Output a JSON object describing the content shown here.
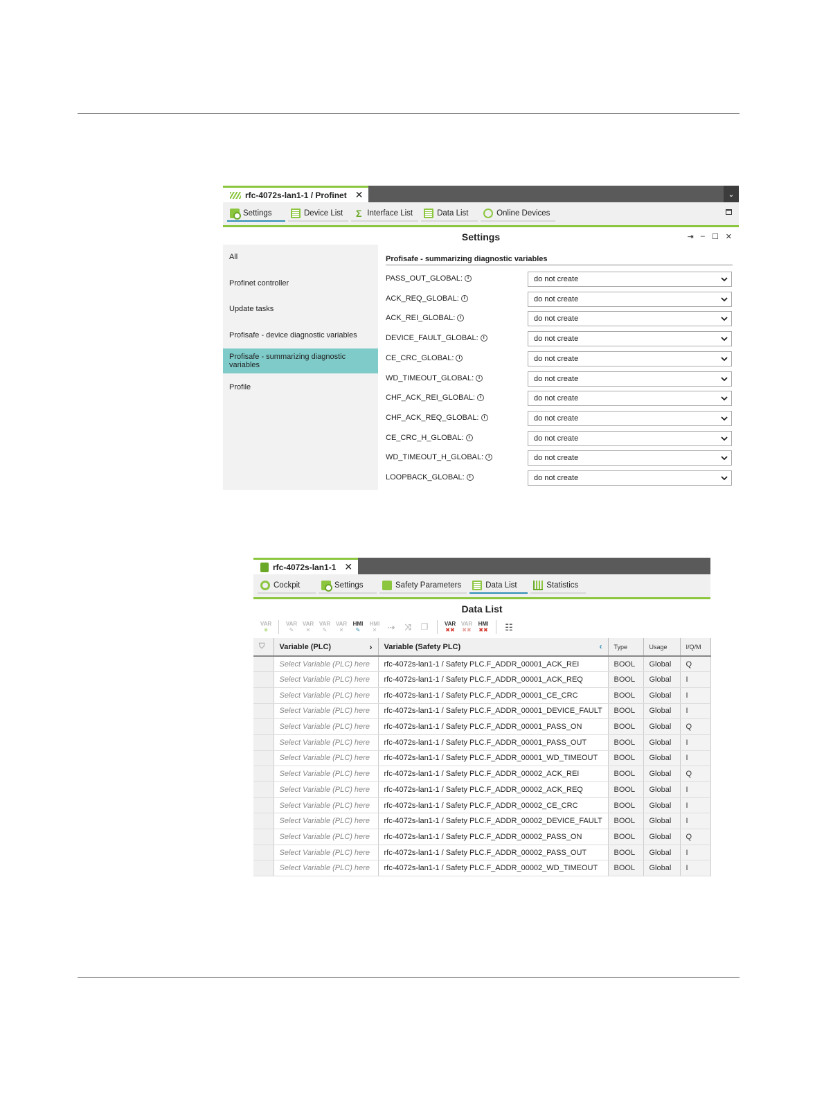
{
  "settings_panel": {
    "doc_tab": "rfc-4072s-lan1-1 / Profinet",
    "tools": [
      {
        "label": "Settings",
        "icon": "settings-icon"
      },
      {
        "label": "Device List",
        "icon": "device-list-icon"
      },
      {
        "label": "Interface List",
        "icon": "interface-list-icon"
      },
      {
        "label": "Data List",
        "icon": "data-list-icon"
      },
      {
        "label": "Online Devices",
        "icon": "online-devices-icon"
      }
    ],
    "title": "Settings",
    "nav": [
      "All",
      "Profinet controller",
      "Update tasks",
      "Profisafe - device diagnostic variables",
      "Profisafe - summarizing diagnostic variables",
      "Profile"
    ],
    "section_title": "Profisafe - summarizing diagnostic variables",
    "rows": [
      {
        "label": "PASS_OUT_GLOBAL:",
        "value": "do not create"
      },
      {
        "label": "ACK_REQ_GLOBAL:",
        "value": "do not create"
      },
      {
        "label": "ACK_REI_GLOBAL:",
        "value": "do not create"
      },
      {
        "label": "DEVICE_FAULT_GLOBAL:",
        "value": "do not create"
      },
      {
        "label": "CE_CRC_GLOBAL:",
        "value": "do not create"
      },
      {
        "label": "WD_TIMEOUT_GLOBAL:",
        "value": "do not create"
      },
      {
        "label": "CHF_ACK_REI_GLOBAL:",
        "value": "do not create"
      },
      {
        "label": "CHF_ACK_REQ_GLOBAL:",
        "value": "do not create"
      },
      {
        "label": "CE_CRC_H_GLOBAL:",
        "value": "do not create"
      },
      {
        "label": "WD_TIMEOUT_H_GLOBAL:",
        "value": "do not create"
      },
      {
        "label": "LOOPBACK_GLOBAL:",
        "value": "do not create"
      }
    ]
  },
  "data_panel": {
    "doc_tab": "rfc-4072s-lan1-1",
    "tools": [
      {
        "label": "Cockpit",
        "icon": "cockpit-icon"
      },
      {
        "label": "Settings",
        "icon": "settings-icon"
      },
      {
        "label": "Safety Parameters",
        "icon": "safety-parameters-icon"
      },
      {
        "label": "Data List",
        "icon": "data-list-icon"
      },
      {
        "label": "Statistics",
        "icon": "statistics-icon"
      }
    ],
    "title": "Data List",
    "toolbar_icons": [
      "VAR",
      "VAR",
      "VAR",
      "VAR",
      "VAR",
      "HMI",
      "HMI",
      "VAR",
      "VAR",
      "HMI"
    ],
    "columns": {
      "var_plc": "Variable (PLC)",
      "var_safety": "Variable (Safety PLC)",
      "type": "Type",
      "usage": "Usage",
      "iqm": "I/Q/M"
    },
    "rows": [
      {
        "plc": "Select Variable (PLC) here",
        "safety": "rfc-4072s-lan1-1 / Safety PLC.F_ADDR_00001_ACK_REI",
        "type": "BOOL",
        "usage": "Global",
        "iqm": "Q"
      },
      {
        "plc": "Select Variable (PLC) here",
        "safety": "rfc-4072s-lan1-1 / Safety PLC.F_ADDR_00001_ACK_REQ",
        "type": "BOOL",
        "usage": "Global",
        "iqm": "I"
      },
      {
        "plc": "Select Variable (PLC) here",
        "safety": "rfc-4072s-lan1-1 / Safety PLC.F_ADDR_00001_CE_CRC",
        "type": "BOOL",
        "usage": "Global",
        "iqm": "I"
      },
      {
        "plc": "Select Variable (PLC) here",
        "safety": "rfc-4072s-lan1-1 / Safety PLC.F_ADDR_00001_DEVICE_FAULT",
        "type": "BOOL",
        "usage": "Global",
        "iqm": "I"
      },
      {
        "plc": "Select Variable (PLC) here",
        "safety": "rfc-4072s-lan1-1 / Safety PLC.F_ADDR_00001_PASS_ON",
        "type": "BOOL",
        "usage": "Global",
        "iqm": "Q"
      },
      {
        "plc": "Select Variable (PLC) here",
        "safety": "rfc-4072s-lan1-1 / Safety PLC.F_ADDR_00001_PASS_OUT",
        "type": "BOOL",
        "usage": "Global",
        "iqm": "I"
      },
      {
        "plc": "Select Variable (PLC) here",
        "safety": "rfc-4072s-lan1-1 / Safety PLC.F_ADDR_00001_WD_TIMEOUT",
        "type": "BOOL",
        "usage": "Global",
        "iqm": "I"
      },
      {
        "plc": "Select Variable (PLC) here",
        "safety": "rfc-4072s-lan1-1 / Safety PLC.F_ADDR_00002_ACK_REI",
        "type": "BOOL",
        "usage": "Global",
        "iqm": "Q"
      },
      {
        "plc": "Select Variable (PLC) here",
        "safety": "rfc-4072s-lan1-1 / Safety PLC.F_ADDR_00002_ACK_REQ",
        "type": "BOOL",
        "usage": "Global",
        "iqm": "I"
      },
      {
        "plc": "Select Variable (PLC) here",
        "safety": "rfc-4072s-lan1-1 / Safety PLC.F_ADDR_00002_CE_CRC",
        "type": "BOOL",
        "usage": "Global",
        "iqm": "I"
      },
      {
        "plc": "Select Variable (PLC) here",
        "safety": "rfc-4072s-lan1-1 / Safety PLC.F_ADDR_00002_DEVICE_FAULT",
        "type": "BOOL",
        "usage": "Global",
        "iqm": "I"
      },
      {
        "plc": "Select Variable (PLC) here",
        "safety": "rfc-4072s-lan1-1 / Safety PLC.F_ADDR_00002_PASS_ON",
        "type": "BOOL",
        "usage": "Global",
        "iqm": "Q"
      },
      {
        "plc": "Select Variable (PLC) here",
        "safety": "rfc-4072s-lan1-1 / Safety PLC.F_ADDR_00002_PASS_OUT",
        "type": "BOOL",
        "usage": "Global",
        "iqm": "I"
      },
      {
        "plc": "Select Variable (PLC) here",
        "safety": "rfc-4072s-lan1-1 / Safety PLC.F_ADDR_00002_WD_TIMEOUT",
        "type": "BOOL",
        "usage": "Global",
        "iqm": "I"
      }
    ]
  }
}
